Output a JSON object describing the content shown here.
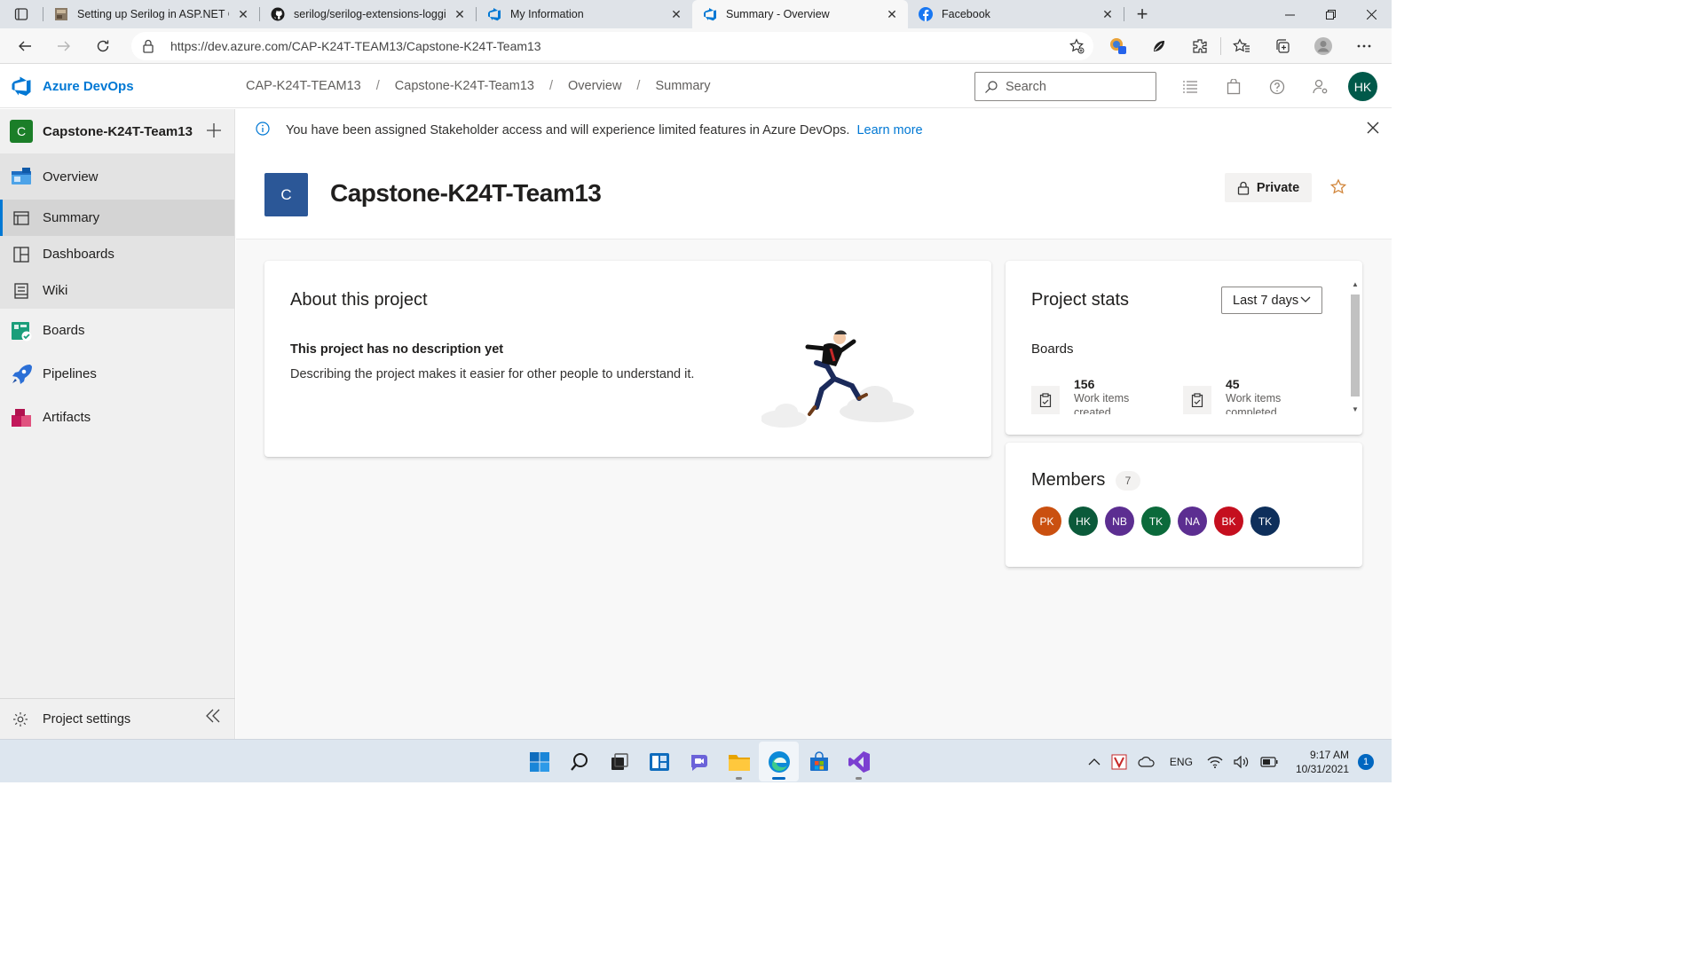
{
  "browser": {
    "tabs": [
      {
        "label": "Setting up Serilog in ASP.NET Co",
        "icon": "article-thumb-icon",
        "active": false
      },
      {
        "label": "serilog/serilog-extensions-loggi",
        "icon": "github-icon",
        "active": false
      },
      {
        "label": "My Information",
        "icon": "azure-devops-icon",
        "active": false
      },
      {
        "label": "Summary - Overview",
        "icon": "azure-devops-icon",
        "active": true
      },
      {
        "label": "Facebook",
        "icon": "facebook-icon",
        "active": false
      }
    ],
    "url": "https://dev.azure.com/CAP-K24T-TEAM13/Capstone-K24T-Team13"
  },
  "header": {
    "brand": "Azure DevOps",
    "breadcrumbs": [
      "CAP-K24T-TEAM13",
      "Capstone-K24T-Team13",
      "Overview",
      "Summary"
    ],
    "search_placeholder": "Search",
    "user_initials": "HK"
  },
  "sidebar": {
    "project_initial": "C",
    "project_name": "Capstone-K24T-Team13",
    "items": [
      {
        "label": "Overview",
        "icon": "overview-icon"
      },
      {
        "label": "Summary",
        "icon": "summary-icon",
        "selected": true
      },
      {
        "label": "Dashboards",
        "icon": "dashboards-icon"
      },
      {
        "label": "Wiki",
        "icon": "wiki-icon"
      },
      {
        "label": "Boards",
        "icon": "boards-icon"
      },
      {
        "label": "Pipelines",
        "icon": "pipelines-icon"
      },
      {
        "label": "Artifacts",
        "icon": "artifacts-icon"
      }
    ],
    "settings_label": "Project settings"
  },
  "banner": {
    "message": "You have been assigned Stakeholder access and will experience limited features in Azure DevOps.",
    "link": "Learn more"
  },
  "project": {
    "initial": "C",
    "title": "Capstone-K24T-Team13",
    "visibility": "Private"
  },
  "about": {
    "title": "About this project",
    "heading": "This project has no description yet",
    "text": "Describing the project makes it easier for other people to understand it."
  },
  "stats": {
    "title": "Project stats",
    "range": "Last 7 days",
    "section": "Boards",
    "items": [
      {
        "value": "156",
        "label1": "Work items",
        "label2": "created"
      },
      {
        "value": "45",
        "label1": "Work items",
        "label2": "completed"
      }
    ]
  },
  "members": {
    "title": "Members",
    "count": "7",
    "list": [
      {
        "initials": "PK",
        "color": "#ca5010"
      },
      {
        "initials": "HK",
        "color": "#0b5a3a"
      },
      {
        "initials": "NB",
        "color": "#5c2e91"
      },
      {
        "initials": "TK",
        "color": "#0b6a3b"
      },
      {
        "initials": "NA",
        "color": "#5c2e91"
      },
      {
        "initials": "BK",
        "color": "#c50f1f"
      },
      {
        "initials": "TK",
        "color": "#0e2f5b"
      }
    ]
  },
  "taskbar": {
    "apps": [
      "start-icon",
      "search-icon",
      "task-view-icon",
      "widgets-icon",
      "teams-chat-icon",
      "file-explorer-icon",
      "edge-icon",
      "store-icon",
      "visual-studio-icon"
    ],
    "language": "ENG",
    "time": "9:17 AM",
    "date": "10/31/2021",
    "notifications": "1"
  }
}
